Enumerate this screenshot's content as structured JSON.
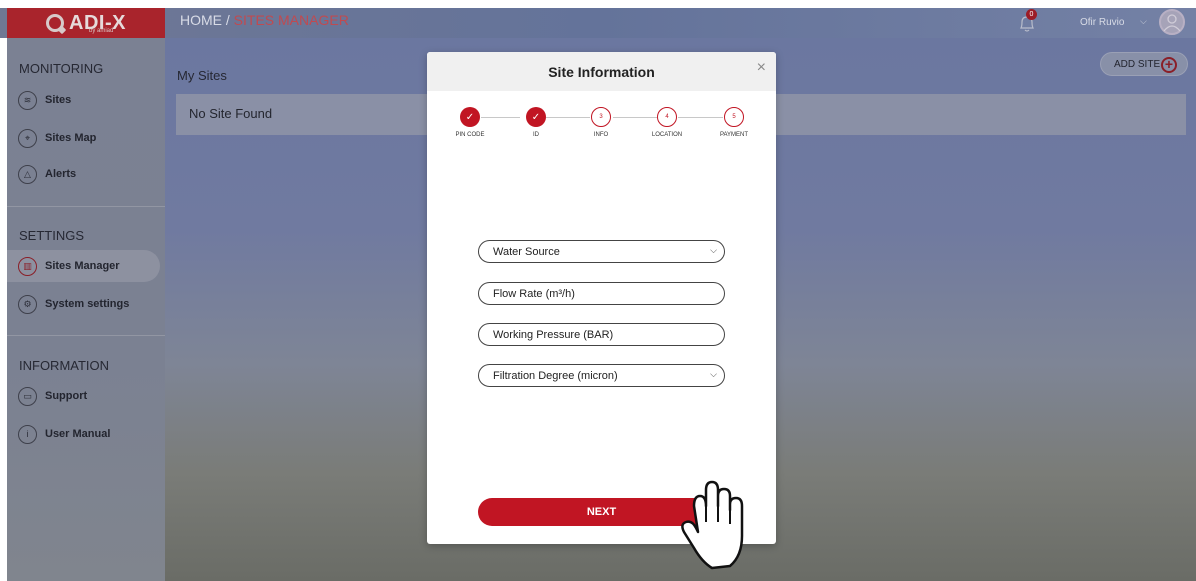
{
  "header": {
    "logo_text": "ADI-X",
    "logo_sub": "by amiad",
    "breadcrumb_home": "HOME / ",
    "breadcrumb_current": "SITES MANAGER",
    "notification_count": "0",
    "user_name": "Ofir Ruvio"
  },
  "sidebar": {
    "monitoring_title": "MONITORING",
    "monitoring_items": [
      {
        "label": "Sites",
        "icon": "layers-icon"
      },
      {
        "label": "Sites Map",
        "icon": "map-pin-icon"
      },
      {
        "label": "Alerts",
        "icon": "bell-icon"
      }
    ],
    "settings_title": "SETTINGS",
    "settings_items": [
      {
        "label": "Sites Manager",
        "icon": "sliders-icon",
        "active": true
      },
      {
        "label": "System settings",
        "icon": "gear-icon"
      }
    ],
    "information_title": "INFORMATION",
    "information_items": [
      {
        "label": "Support",
        "icon": "chat-icon"
      },
      {
        "label": "User Manual",
        "icon": "info-icon"
      }
    ]
  },
  "main": {
    "my_sites_title": "My Sites",
    "no_site_text": "No Site Found",
    "add_site_label": "ADD SITE"
  },
  "modal": {
    "title": "Site Information",
    "close": "×",
    "steps": [
      {
        "num": "✓",
        "label": "PIN CODE",
        "done": true
      },
      {
        "num": "✓",
        "label": "ID",
        "done": true
      },
      {
        "num": "3",
        "label": "INFO",
        "done": false
      },
      {
        "num": "4",
        "label": "LOCATION",
        "done": false
      },
      {
        "num": "5",
        "label": "PAYMENT",
        "done": false
      }
    ],
    "fields": {
      "water_source": "Water Source",
      "flow_rate": "Flow Rate (m³/h)",
      "working_pressure": "Working Pressure (BAR)",
      "filtration_degree": "Filtration Degree (micron)"
    },
    "next_label": "NEXT"
  },
  "colors": {
    "brand_red": "#c11523",
    "header_bg": "#6f7894",
    "modal_bg": "#ffffff"
  }
}
